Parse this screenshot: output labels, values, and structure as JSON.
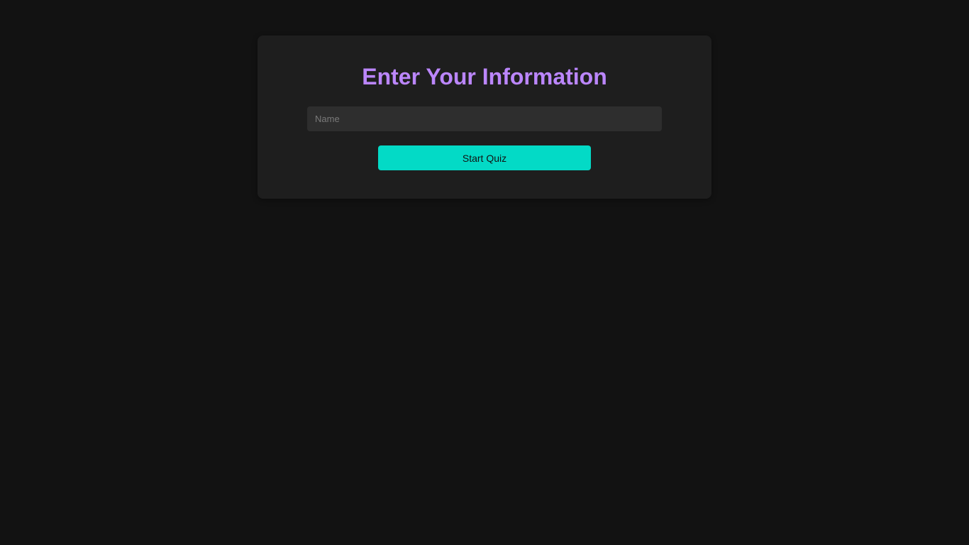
{
  "form": {
    "title": "Enter Your Information",
    "name_input": {
      "value": "",
      "placeholder": "Name"
    },
    "start_button_label": "Start Quiz"
  },
  "colors": {
    "background": "#121212",
    "card": "#1e1e1e",
    "title": "#bb86fc",
    "input_background": "#2e2e2e",
    "button": "#03dac6"
  }
}
